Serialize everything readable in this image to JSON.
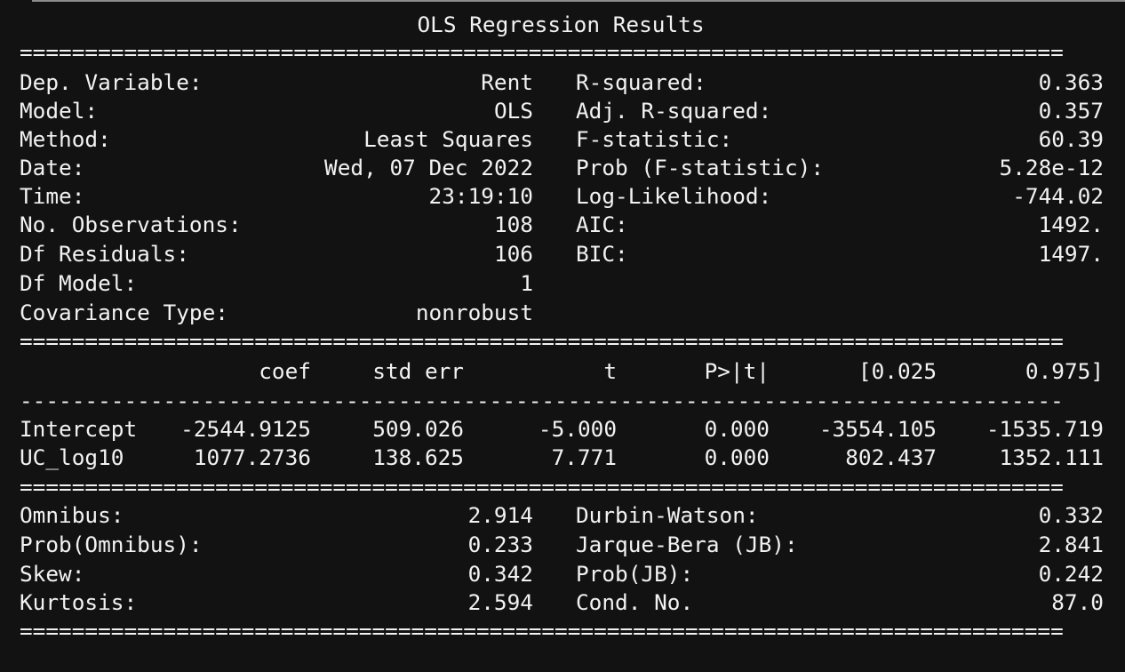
{
  "title": "OLS Regression Results",
  "rule_double": "================================================================================",
  "rule_single": "--------------------------------------------------------------------------------",
  "summary_rows": [
    {
      "label": "Dep. Variable:",
      "value": "Rent",
      "stat": "R-squared:",
      "stat_value": "0.363"
    },
    {
      "label": "Model:",
      "value": "OLS",
      "stat": "Adj. R-squared:",
      "stat_value": "0.357"
    },
    {
      "label": "Method:",
      "value": "Least Squares",
      "stat": "F-statistic:",
      "stat_value": "60.39"
    },
    {
      "label": "Date:",
      "value": "Wed, 07 Dec 2022",
      "stat": "Prob (F-statistic):",
      "stat_value": "5.28e-12"
    },
    {
      "label": "Time:",
      "value": "23:19:10",
      "stat": "Log-Likelihood:",
      "stat_value": "-744.02"
    },
    {
      "label": "No. Observations:",
      "value": "108",
      "stat": "AIC:",
      "stat_value": "1492."
    },
    {
      "label": "Df Residuals:",
      "value": "106",
      "stat": "BIC:",
      "stat_value": "1497."
    },
    {
      "label": "Df Model:",
      "value": "1",
      "stat": "",
      "stat_value": ""
    },
    {
      "label": "Covariance Type:",
      "value": "nonrobust",
      "stat": "",
      "stat_value": ""
    }
  ],
  "coef_table": {
    "headers": [
      "coef",
      "std err",
      "t",
      "P>|t|",
      "[0.025",
      "0.975]"
    ],
    "rows": [
      {
        "name": "Intercept",
        "coef": "-2544.9125",
        "std_err": "509.026",
        "t": "-5.000",
        "p": "0.000",
        "ci_low": "-3554.105",
        "ci_high": "-1535.719"
      },
      {
        "name": "UC_log10",
        "coef": "1077.2736",
        "std_err": "138.625",
        "t": "7.771",
        "p": "0.000",
        "ci_low": "802.437",
        "ci_high": "1352.111"
      }
    ]
  },
  "diagnostics": [
    {
      "label": "Omnibus:",
      "value": "2.914",
      "stat": "Durbin-Watson:",
      "stat_value": "0.332"
    },
    {
      "label": "Prob(Omnibus):",
      "value": "0.233",
      "stat": "Jarque-Bera (JB):",
      "stat_value": "2.841"
    },
    {
      "label": "Skew:",
      "value": "0.342",
      "stat": "Prob(JB):",
      "stat_value": "0.242"
    },
    {
      "label": "Kurtosis:",
      "value": "2.594",
      "stat": "Cond. No.",
      "stat_value": "87.0"
    }
  ]
}
